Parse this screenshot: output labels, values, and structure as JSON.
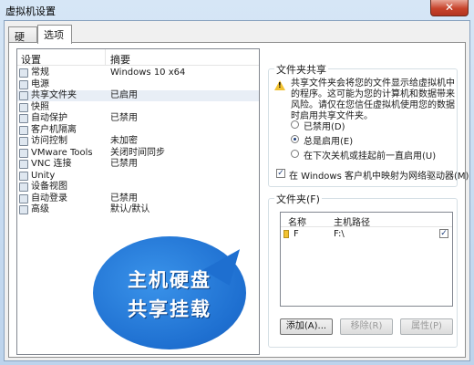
{
  "window": {
    "title": "虚拟机设置",
    "close_glyph": "✕"
  },
  "tabs": [
    {
      "label": "硬件"
    },
    {
      "label": "选项"
    }
  ],
  "settings_list": {
    "col_setting": "设置",
    "col_summary": "摘要",
    "rows": [
      {
        "name": "常规",
        "summary": "Windows 10 x64"
      },
      {
        "name": "电源",
        "summary": ""
      },
      {
        "name": "共享文件夹",
        "summary": "已启用"
      },
      {
        "name": "快照",
        "summary": ""
      },
      {
        "name": "自动保护",
        "summary": "已禁用"
      },
      {
        "name": "客户机隔离",
        "summary": ""
      },
      {
        "name": "访问控制",
        "summary": "未加密"
      },
      {
        "name": "VMware Tools",
        "summary": "关闭时间同步"
      },
      {
        "name": "VNC 连接",
        "summary": "已禁用"
      },
      {
        "name": "Unity",
        "summary": ""
      },
      {
        "name": "设备视图",
        "summary": ""
      },
      {
        "name": "自动登录",
        "summary": "已禁用"
      },
      {
        "name": "高级",
        "summary": "默认/默认"
      }
    ]
  },
  "annotation": {
    "line1": "主机硬盘",
    "line2": "共享挂载",
    "color": "#1e6fd0"
  },
  "folder_sharing": {
    "title": "文件夹共享",
    "warning": "共享文件夹会将您的文件显示给虚拟机中的程序。这可能为您的计算机和数据带来风险。请仅在您信任虚拟机使用您的数据时启用共享文件夹。",
    "options": [
      {
        "label": "已禁用(D)",
        "selected": false
      },
      {
        "label": "总是启用(E)",
        "selected": true
      },
      {
        "label": "在下次关机或挂起前一直启用(U)",
        "selected": false
      }
    ],
    "map_drive": {
      "label": "在 Windows 客户机中映射为网络驱动器(M)",
      "checked": true
    }
  },
  "folders": {
    "title": "文件夹(F)",
    "col_name": "名称",
    "col_host_path": "主机路径",
    "rows": [
      {
        "name": "F",
        "host_path": "F:\\",
        "enabled": true
      }
    ],
    "buttons": {
      "add": "添加(A)...",
      "remove": "移除(R)",
      "properties": "属性(P)"
    }
  }
}
